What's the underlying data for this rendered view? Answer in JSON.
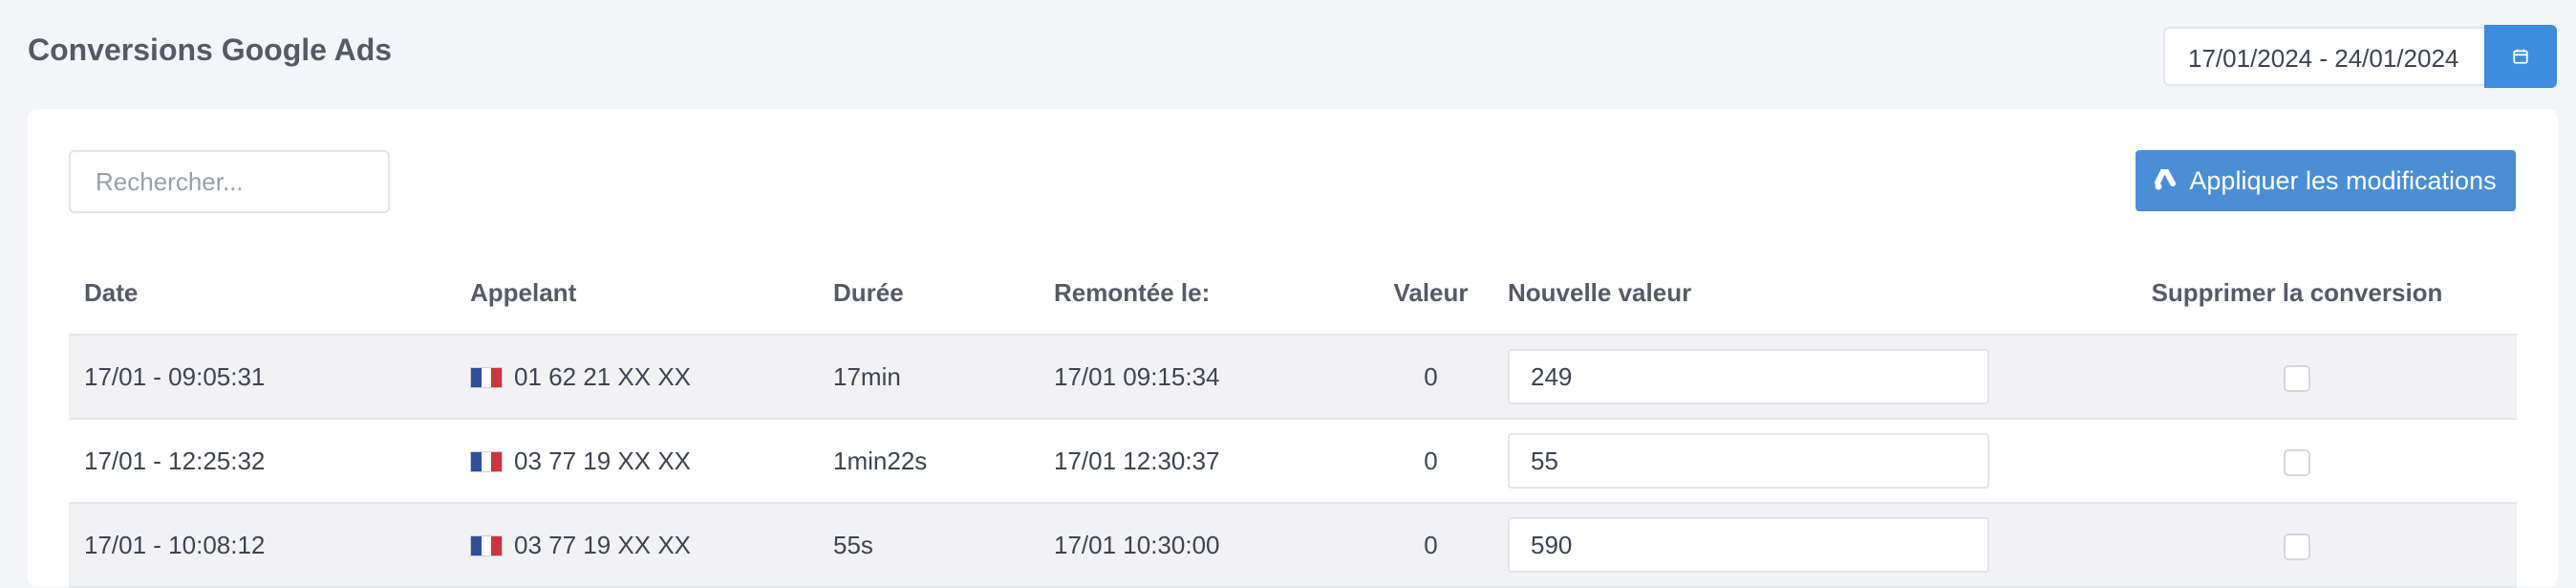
{
  "header": {
    "title": "Conversions Google Ads",
    "date_range": "17/01/2024 - 24/01/2024",
    "calendar_icon": "calendar-icon"
  },
  "toolbar": {
    "search_placeholder": "Rechercher...",
    "apply_label": "Appliquer les modifications",
    "apply_icon": "google-ads-icon"
  },
  "table": {
    "columns": {
      "date": "Date",
      "caller": "Appelant",
      "duration": "Durée",
      "remontee": "Remontée le:",
      "valeur": "Valeur",
      "new_value": "Nouvelle valeur",
      "delete": "Supprimer la conversion"
    },
    "rows": [
      {
        "date": "17/01 - 09:05:31",
        "caller": "01 62 21 XX XX",
        "duration": "17min",
        "remontee": "17/01 09:15:34",
        "valeur": "0",
        "new_value": "249",
        "delete": false
      },
      {
        "date": "17/01 - 12:25:32",
        "caller": "03 77 19 XX XX",
        "duration": "1min22s",
        "remontee": "17/01 12:30:37",
        "valeur": "0",
        "new_value": "55",
        "delete": false
      },
      {
        "date": "17/01 - 10:08:12",
        "caller": "03 77 19 XX XX",
        "duration": "55s",
        "remontee": "17/01 10:30:00",
        "valeur": "0",
        "new_value": "590",
        "delete": false
      }
    ]
  },
  "colors": {
    "primary": "#3d8de0",
    "apply_button": "#4a8ed6",
    "flag_blue": "#2f4f9a",
    "flag_white": "#ffffff",
    "flag_red": "#d0343b"
  }
}
